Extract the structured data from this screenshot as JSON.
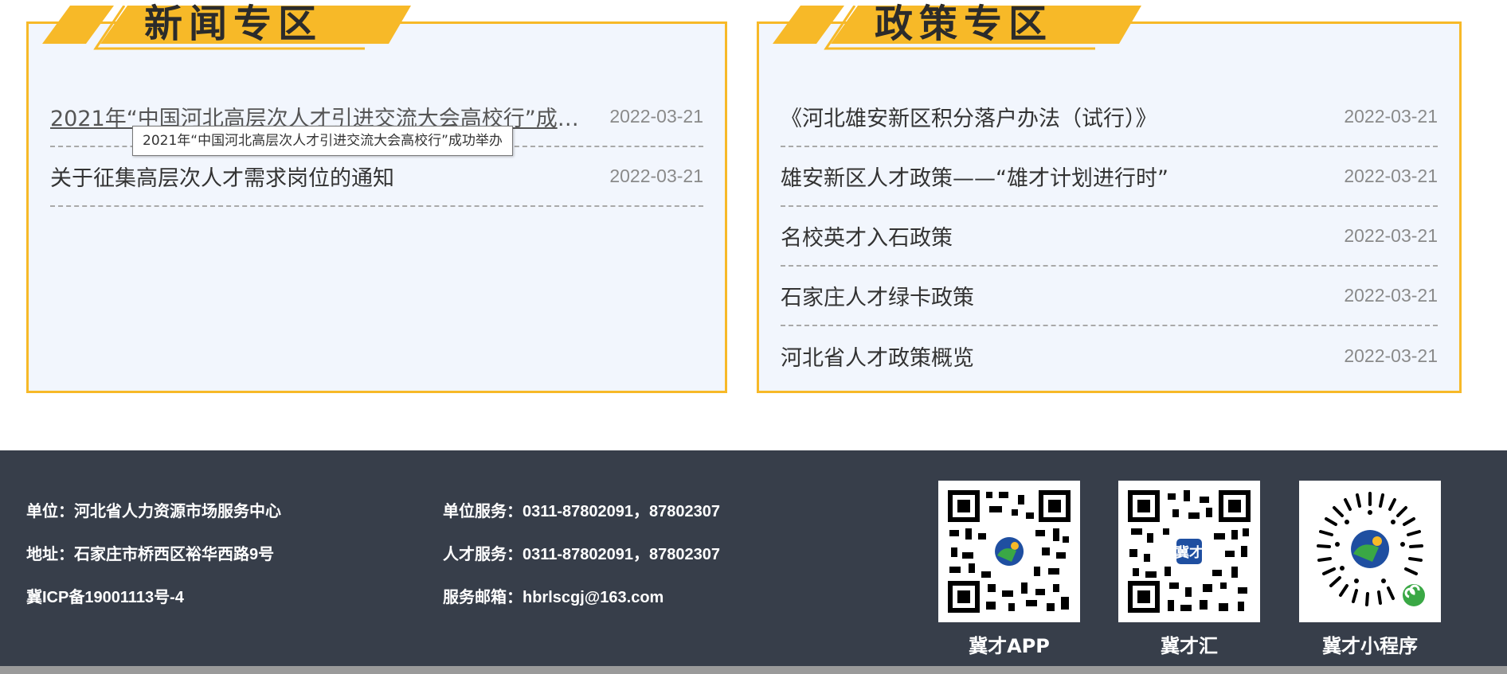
{
  "news": {
    "title": "新闻专区",
    "items": [
      {
        "title": "2021年“中国河北高层次人才引进交流大会高校行”成功举办",
        "date": "2022-03-21"
      },
      {
        "title": "关于征集高层次人才需求岗位的通知",
        "date": "2022-03-21"
      }
    ],
    "tooltip": "2021年“中国河北高层次人才引进交流大会高校行”成功举办"
  },
  "policy": {
    "title": "政策专区",
    "items": [
      {
        "title": "《河北雄安新区积分落户办法（试行）》",
        "date": "2022-03-21"
      },
      {
        "title": "雄安新区人才政策——“雄才计划进行时”",
        "date": "2022-03-21"
      },
      {
        "title": "名校英才入石政策",
        "date": "2022-03-21"
      },
      {
        "title": "石家庄人才绿卡政策",
        "date": "2022-03-21"
      },
      {
        "title": "河北省人才政策概览",
        "date": "2022-03-21"
      }
    ]
  },
  "footer": {
    "unit": "单位：河北省人力资源市场服务中心",
    "address": "地址：石家庄市桥西区裕华西路9号",
    "icp": "冀ICP备19001113号-4",
    "unit_service": "单位服务：0311-87802091，87802307",
    "talent_service": "人才服务：0311-87802091，87802307",
    "email": "服务邮箱：hbrlscgj@163.com",
    "qr_codes": [
      {
        "label": "冀才APP",
        "icon": "qr-code-icon"
      },
      {
        "label": "冀才汇",
        "icon": "qr-code-icon"
      },
      {
        "label": "冀才小程序",
        "icon": "mini-program-code-icon"
      }
    ]
  },
  "colors": {
    "accent": "#f7b928",
    "panel_bg": "#f2f6fd",
    "footer_bg": "#373e4a"
  }
}
